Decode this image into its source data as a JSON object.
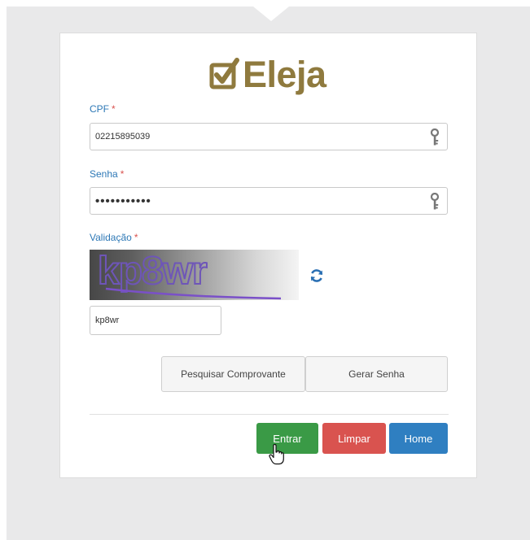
{
  "logo": {
    "text": "Eleja"
  },
  "form": {
    "cpf": {
      "label": "CPF",
      "required": "*",
      "value": "02215895039"
    },
    "senha": {
      "label": "Senha",
      "required": "*",
      "value": "•••••••••••"
    },
    "validacao": {
      "label": "Validação",
      "required": "*",
      "captcha_text": "kp8wr",
      "value": "kp8wr"
    }
  },
  "buttons": {
    "pesquisar": "Pesquisar Comprovante",
    "gerar": "Gerar Senha",
    "entrar": "Entrar",
    "limpar": "Limpar",
    "home": "Home"
  },
  "colors": {
    "brand": "#8f7a3e",
    "label": "#2d78b6",
    "required": "#d9534f",
    "entrar": "#3a9a46",
    "limpar": "#d9534f",
    "home": "#2f7fc1"
  },
  "icons": [
    "checkbox-logo-icon",
    "key-icon",
    "refresh-icon",
    "hand-cursor-icon"
  ]
}
